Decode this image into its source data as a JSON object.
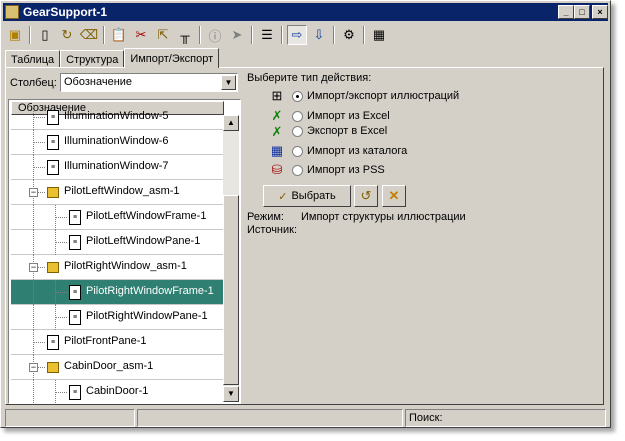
{
  "window": {
    "title": "GearSupport-1",
    "minimize": "_",
    "maximize": "□",
    "close": "×"
  },
  "toolbar": {
    "icons": [
      "open-assembly-icon",
      "new-document-icon",
      "refresh-icon",
      "delete-icon",
      "paste-icon",
      "cut-icon",
      "move-icon",
      "structure-icon",
      "properties-icon",
      "pin-icon",
      "outline-icon",
      "import-icon",
      "export-icon",
      "settings-icon",
      "grid-icon"
    ]
  },
  "tabs": [
    {
      "label": "Таблица",
      "active": false
    },
    {
      "label": "Структура",
      "active": false
    },
    {
      "label": "Импорт/Экспорт",
      "active": true
    }
  ],
  "column_filter": {
    "label": "Столбец:",
    "value": "Обозначение"
  },
  "tree": {
    "header": "Обозначение",
    "rows": [
      {
        "label": "IlluminationWindow-5",
        "type": "doc",
        "level": 1,
        "selected": false
      },
      {
        "label": "IlluminationWindow-6",
        "type": "doc",
        "level": 1,
        "selected": false
      },
      {
        "label": "IlluminationWindow-7",
        "type": "doc",
        "level": 1,
        "selected": false
      },
      {
        "label": "PilotLeftWindow_asm-1",
        "type": "asm",
        "level": 1,
        "selected": false
      },
      {
        "label": "PilotLeftWindowFrame-1",
        "type": "doc",
        "level": 2,
        "selected": false
      },
      {
        "label": "PilotLeftWindowPane-1",
        "type": "doc",
        "level": 2,
        "selected": false
      },
      {
        "label": "PilotRightWindow_asm-1",
        "type": "asm",
        "level": 1,
        "selected": false
      },
      {
        "label": "PilotRightWindowFrame-1",
        "type": "doc",
        "level": 2,
        "selected": true
      },
      {
        "label": "PilotRightWindowPane-1",
        "type": "doc",
        "level": 2,
        "selected": false
      },
      {
        "label": "PilotFrontPane-1",
        "type": "doc",
        "level": 1,
        "selected": false
      },
      {
        "label": "CabinDoor_asm-1",
        "type": "asm",
        "level": 1,
        "selected": false
      },
      {
        "label": "CabinDoor-1",
        "type": "doc",
        "level": 2,
        "selected": false
      }
    ]
  },
  "actions": {
    "prompt": "Выберите тип действия:",
    "options": [
      {
        "label": "Импорт/экспорт иллюстраций",
        "icon": "illustration-icon",
        "checked": true
      },
      {
        "label": "Импорт из Excel",
        "icon": "excel-import-icon",
        "checked": false
      },
      {
        "label": "Экспорт в Excel",
        "icon": "excel-export-icon",
        "checked": false
      },
      {
        "label": "Импорт из каталога",
        "icon": "catalog-icon",
        "checked": false
      },
      {
        "label": "Импорт из PSS",
        "icon": "pss-database-icon",
        "checked": false
      }
    ],
    "select_button": "Выбрать",
    "mode_label": "Режим:",
    "mode_value": "Импорт структуры иллюстрации",
    "source_label": "Источник:",
    "source_value": ""
  },
  "status": {
    "search_label": "Поиск:"
  },
  "colors": {
    "titlebar": "#0a246a",
    "selection": "#2f7f72",
    "face": "#d4d0c8"
  }
}
